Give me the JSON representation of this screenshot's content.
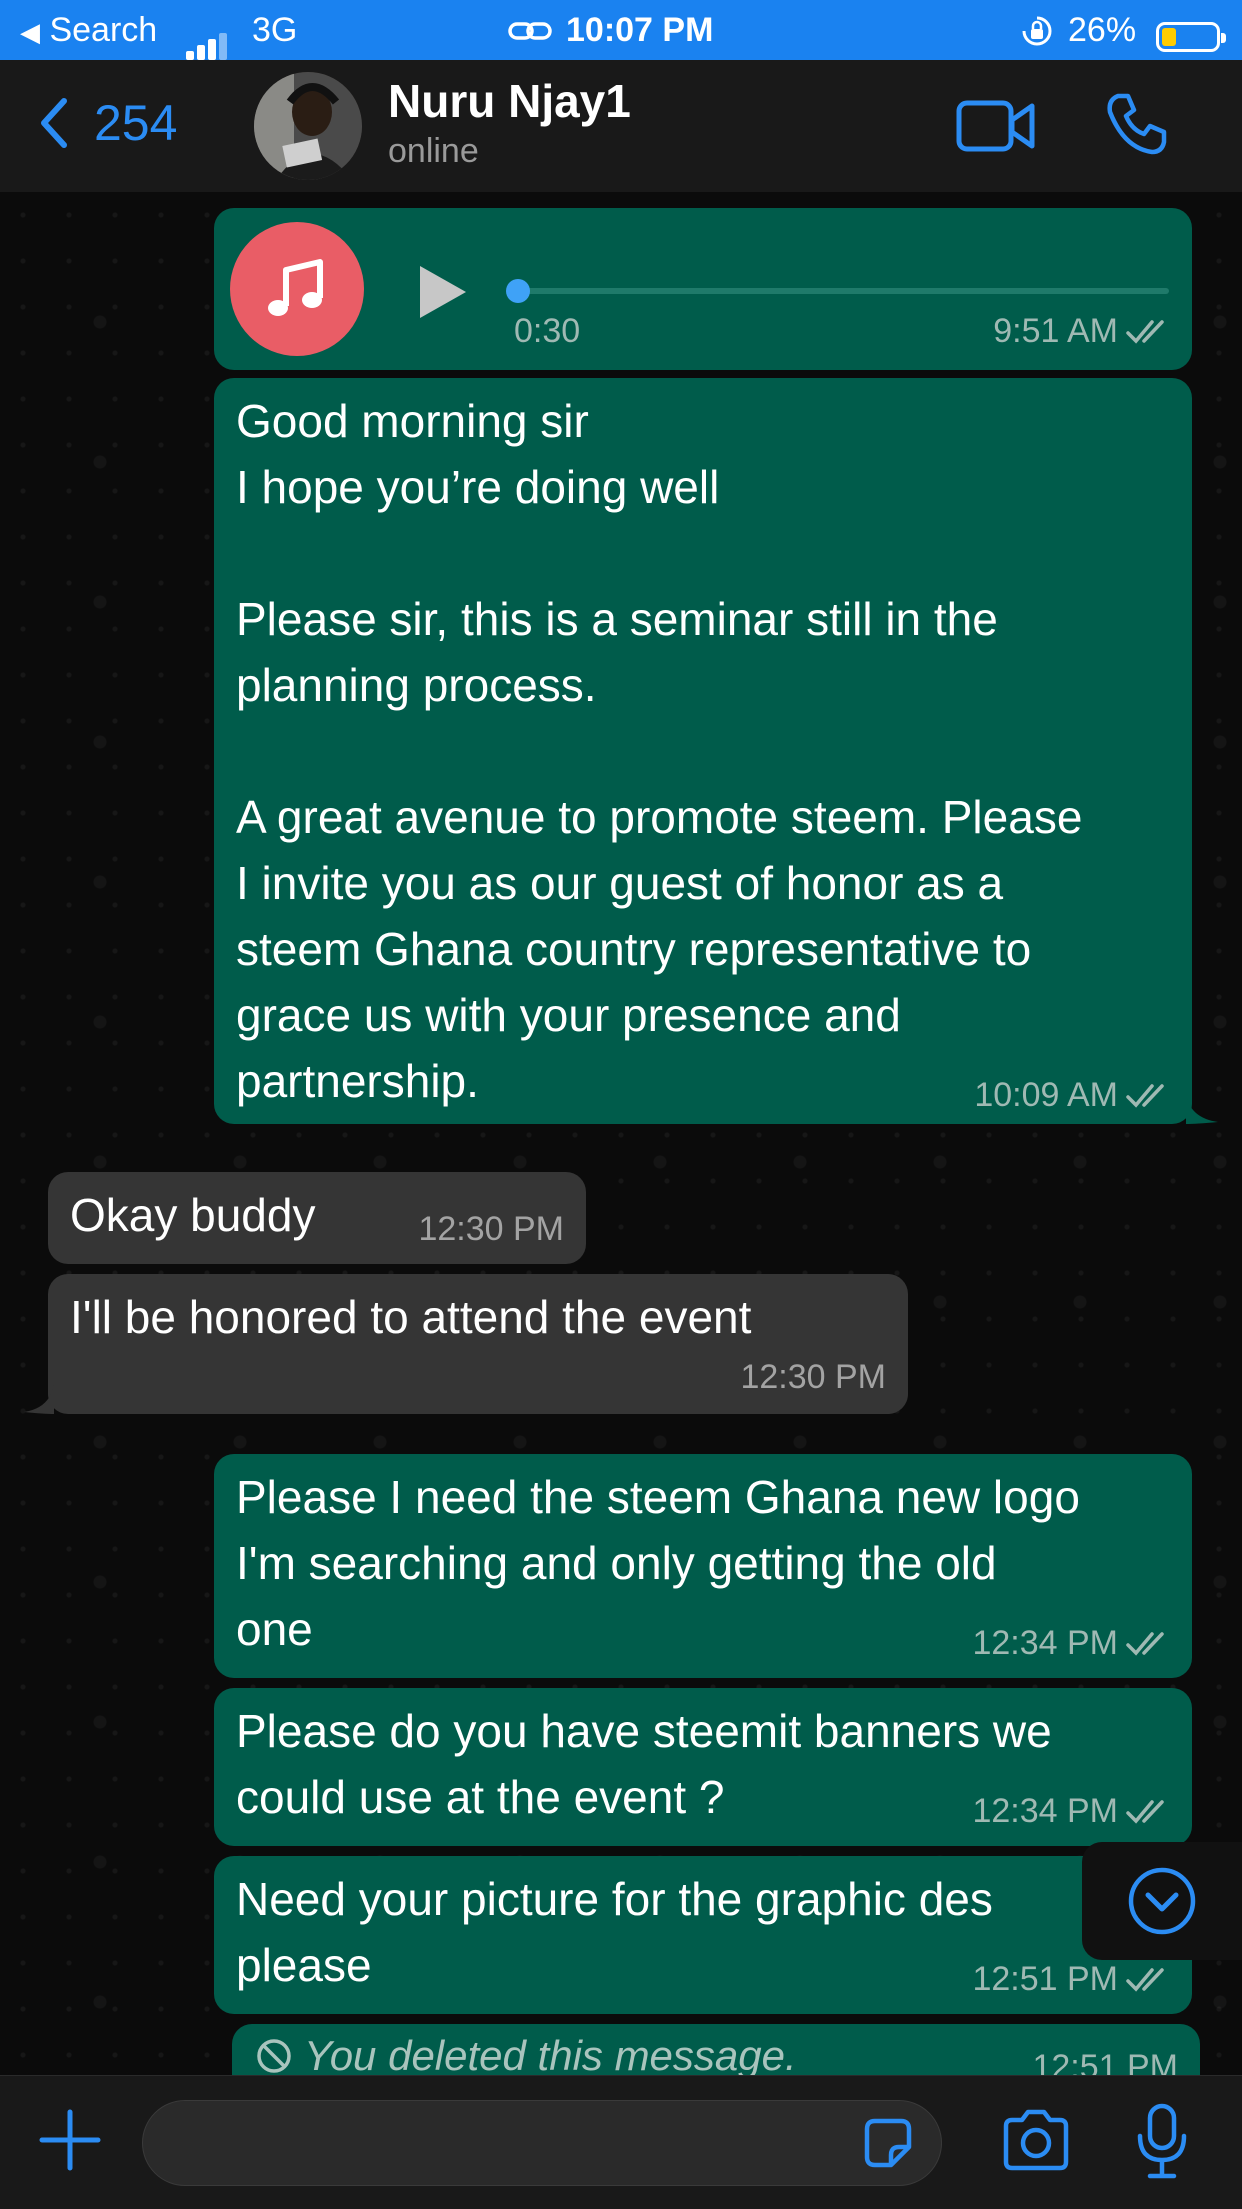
{
  "status_bar": {
    "back_app": "Search",
    "network": "3G",
    "time": "10:07 PM",
    "battery": "26%",
    "battery_level": 0.26
  },
  "header": {
    "back_count": "254",
    "contact_name": "Nuru Njay1",
    "contact_status": "online"
  },
  "messages": {
    "audio": {
      "duration": "0:30",
      "time": "9:51 AM"
    },
    "m1": {
      "text": "Good morning sir\nI hope you’re doing well\n\nPlease sir, this is a seminar still in the\nplanning process.\n\nA great avenue to promote steem. Please\nI invite you as our guest of honor as a\nsteem Ghana country representative to\ngrace us with your presence and\npartnership.",
      "time": "10:09 AM"
    },
    "m2": {
      "text": "Okay buddy",
      "time": "12:30 PM"
    },
    "m3": {
      "text": "I'll be honored to attend the event",
      "time": "12:30 PM"
    },
    "m4": {
      "text": "Please I need the steem Ghana new logo\nI'm searching and only getting the old\none",
      "time": "12:34 PM"
    },
    "m5": {
      "text": "Please do you have steemit banners we\ncould use at the event ?",
      "time": "12:34 PM"
    },
    "m6": {
      "text": "Need your picture for the graphic des\nplease",
      "time": "12:51 PM"
    },
    "m7": {
      "text": "You deleted this message.",
      "time": "12:51 PM"
    }
  },
  "composer": {
    "placeholder": ""
  },
  "colors": {
    "accent": "#2b8cf3",
    "outgoing": "#005c4b",
    "incoming": "#353535",
    "status_bar": "#1a82f0"
  }
}
